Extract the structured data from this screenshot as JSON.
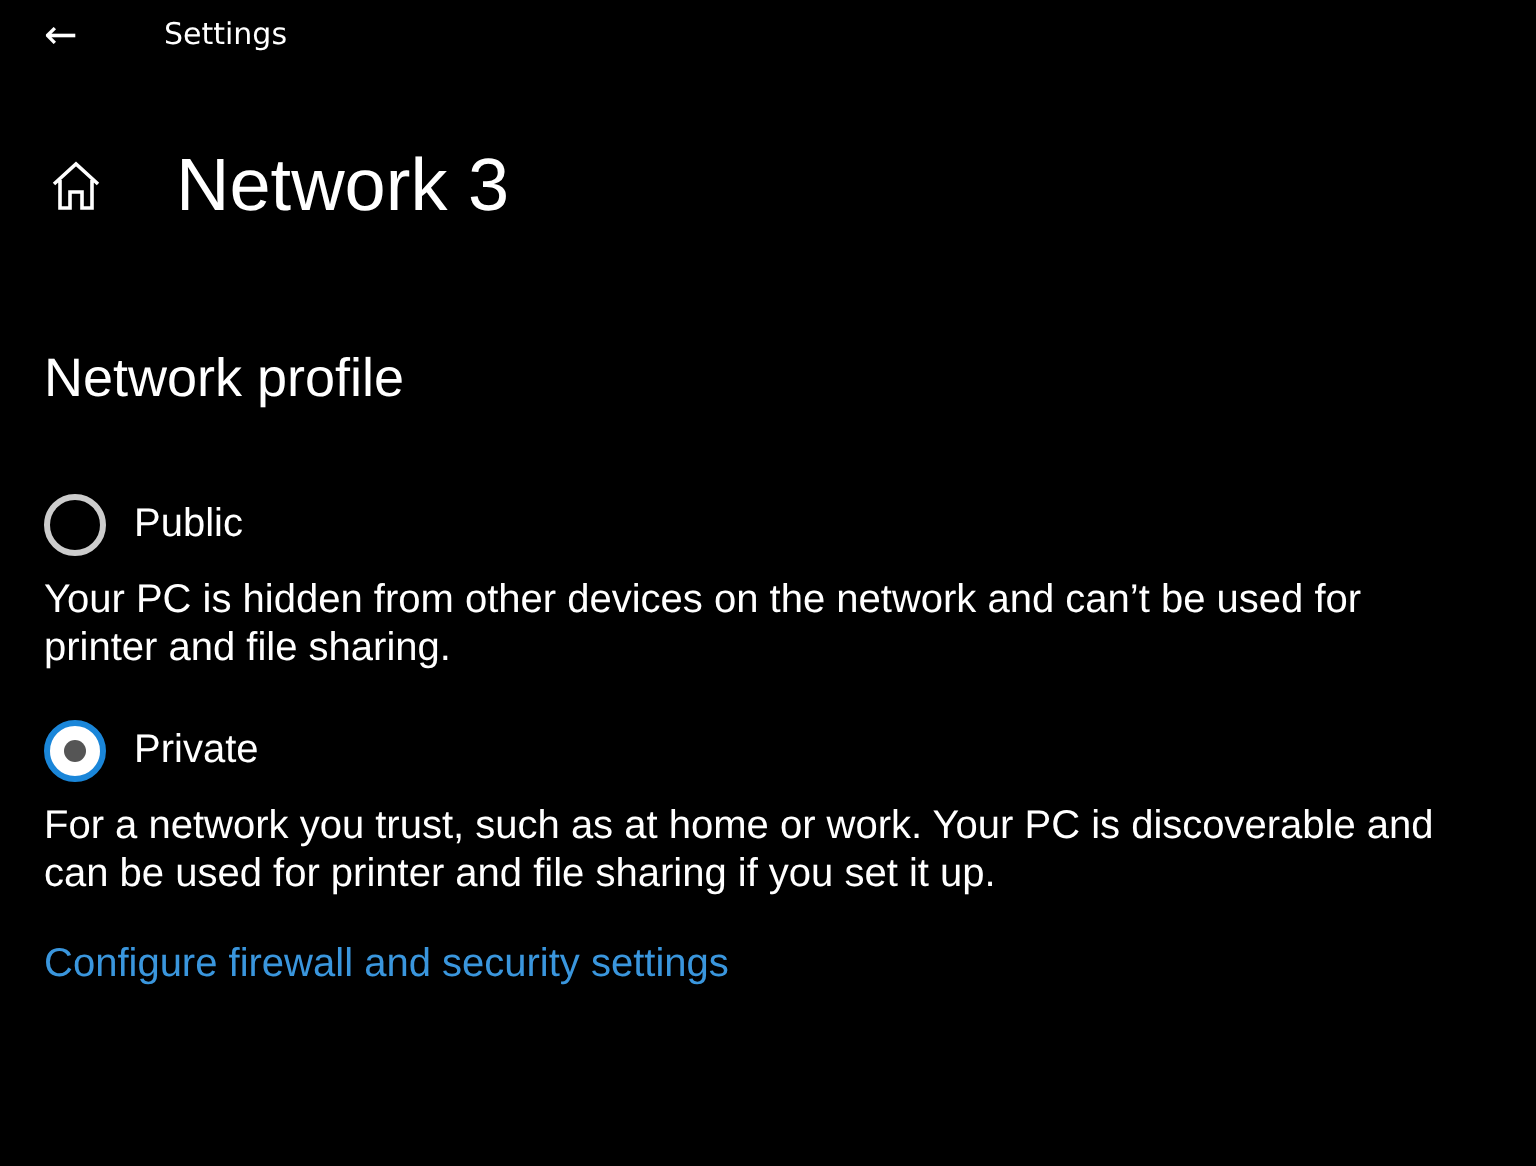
{
  "window": {
    "title": "Settings",
    "back": "←"
  },
  "page": {
    "title": "Network 3"
  },
  "section": {
    "title": "Network profile"
  },
  "options": [
    {
      "label": "Public",
      "selected": false,
      "description": "Your PC is hidden from other devices on the network and can’t be used for printer and file sharing."
    },
    {
      "label": "Private",
      "selected": true,
      "description": "For a network you trust, such as at home or work. Your PC is discoverable and can be used for printer and file sharing if you set it up."
    }
  ],
  "link": "Configure firewall and security settings"
}
